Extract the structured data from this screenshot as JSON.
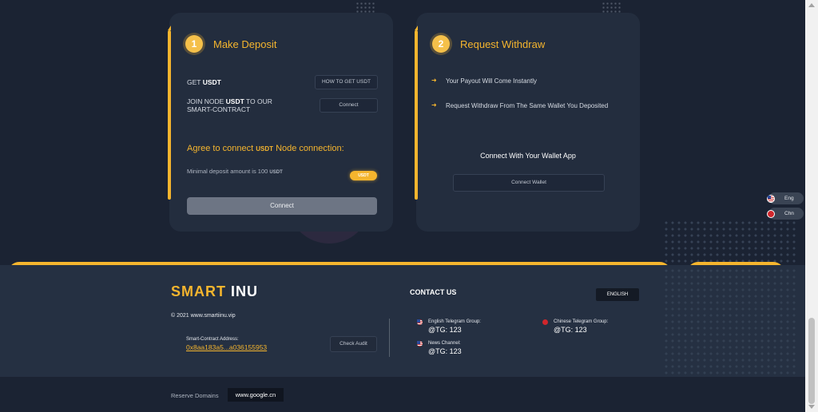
{
  "deposit": {
    "step": "1",
    "title": "Make Deposit",
    "get_prefix": "GET",
    "get_token": "USDT",
    "how_to_button": "HOW TO GET USDT",
    "join_line1_a": "JOIN NODE",
    "join_token": "USDT",
    "join_line1_b": "TO OUR",
    "join_line2": "SMART-CONTRACT",
    "connect_small_button": "Connect",
    "agree_a": "Agree to connect",
    "agree_token": "USDT",
    "agree_b": "Node connection:",
    "minimal_a": "Minimal deposit amount is 100",
    "minimal_token": "USDT",
    "token_pill": "USDT",
    "connect_button": "Connect"
  },
  "withdraw": {
    "step": "2",
    "title": "Request Withdraw",
    "items": [
      "Your Payout Will Come Instantly",
      "Request Withdraw From The Same Wallet You Deposited"
    ],
    "wallet_prompt": "Connect With Your Wallet App",
    "connect_wallet_button": "Connect Wallet"
  },
  "languages": [
    {
      "label": "Eng",
      "flag": "us-flag-icon"
    },
    {
      "label": "Chn",
      "flag": "cn-flag-icon"
    }
  ],
  "footer": {
    "logo_a": "SMART",
    "logo_b": "INU",
    "copyright": "© 2021 www.smartiinu.vip",
    "contract_label": "Smart-Contract Address:",
    "contract_address": "0x8aa183a5...a036155953",
    "check_audit_button": "Check Audit",
    "contact_title": "CONTACT US",
    "english_button": "ENGLISH",
    "english_group_label": "English Telegram Group:",
    "english_group_value": "@TG:  123",
    "news_label": "News Channel:",
    "news_value": "@TG:  123",
    "chinese_group_label": "Chinese Telegram Group:",
    "chinese_group_value": "@TG:  123",
    "reserve_label": "Reserve Domains",
    "reserve_domain": "www.google.cn"
  },
  "colors": {
    "accent": "#f5b52e",
    "background": "#1b2333",
    "card": "#232d3e"
  }
}
